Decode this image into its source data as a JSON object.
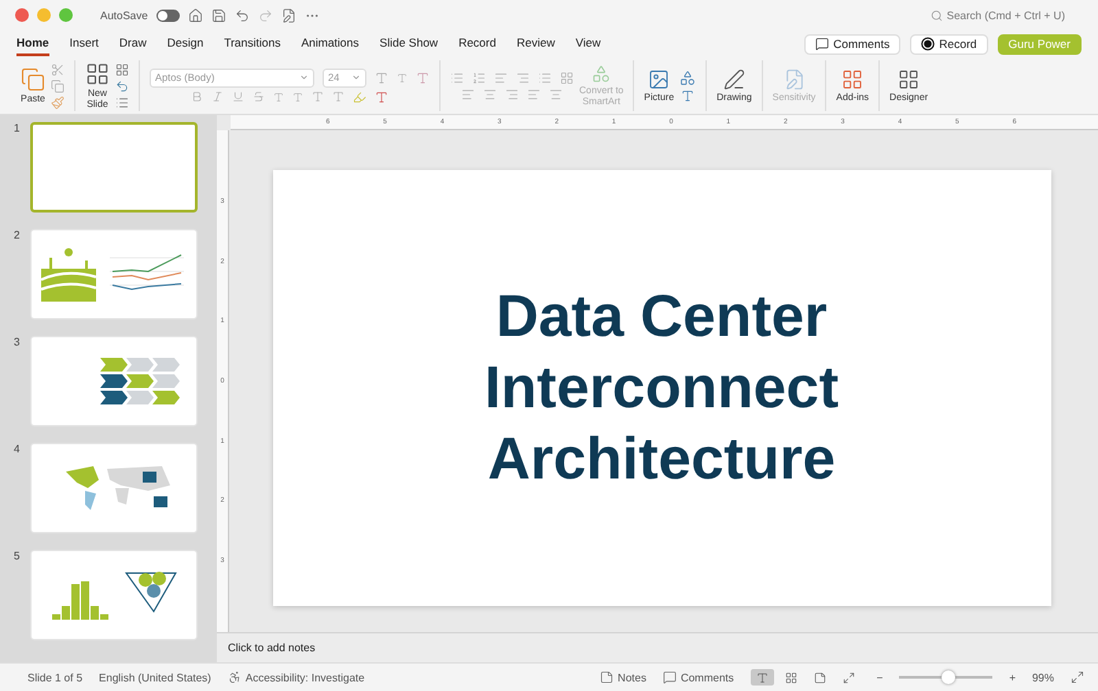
{
  "window": {
    "autosave": {
      "label": "AutoSave",
      "on": false
    },
    "search": {
      "placeholder": "Search (Cmd + Ctrl + U)"
    }
  },
  "tabs": [
    {
      "label": "Home",
      "selected": true
    },
    {
      "label": "Insert",
      "selected": false
    },
    {
      "label": "Draw",
      "selected": false
    },
    {
      "label": "Design",
      "selected": false
    },
    {
      "label": "Transitions",
      "selected": false
    },
    {
      "label": "Animations",
      "selected": false
    },
    {
      "label": "Slide Show",
      "selected": false
    },
    {
      "label": "Record",
      "selected": false
    },
    {
      "label": "Review",
      "selected": false
    },
    {
      "label": "View",
      "selected": false
    }
  ],
  "header_buttons": [
    {
      "kind": "comments",
      "label": "Comments"
    },
    {
      "kind": "record",
      "label": "Record"
    },
    {
      "kind": "guru",
      "label": "Guru Power"
    }
  ],
  "ribbon": {
    "paste": "Paste",
    "new_slide": [
      "New",
      "Slide"
    ],
    "font": "Aptos (Body)",
    "font_size": "24",
    "smartart": [
      "Convert to",
      "SmartArt"
    ],
    "picture": "Picture",
    "drawing": "Drawing",
    "sensitivity": {
      "label": "Sensitivity",
      "disabled": true
    },
    "addins": "Add-ins",
    "designer": "Designer"
  },
  "ruler": {
    "horizontal": [
      "6",
      "5",
      "4",
      "3",
      "2",
      "1",
      "0",
      "1",
      "2",
      "3",
      "4",
      "5",
      "6"
    ],
    "vertical": [
      "3",
      "2",
      "1",
      "0",
      "1",
      "2",
      "3"
    ]
  },
  "slides": [
    {
      "number": "1",
      "kind": "blank",
      "selected": true
    },
    {
      "number": "2",
      "kind": "farm_chart",
      "selected": false
    },
    {
      "number": "3",
      "kind": "arrows",
      "selected": false
    },
    {
      "number": "4",
      "kind": "map",
      "selected": false
    },
    {
      "number": "5",
      "kind": "histogram",
      "selected": false
    }
  ],
  "slide": {
    "title": [
      "Data Center",
      "Interconnect",
      "Architecture"
    ]
  },
  "notes": {
    "placeholder": "Click to add notes"
  },
  "status_bar": {
    "slide": "Slide 1 of 5",
    "language": "English (United States)",
    "accessibility": "Accessibility: Investigate",
    "notes": "Notes",
    "comments": "Comments",
    "views": [
      {
        "kind": "normal",
        "selected": true
      },
      {
        "kind": "sorter",
        "selected": false
      },
      {
        "kind": "reading",
        "selected": false
      },
      {
        "kind": "presenter",
        "selected": false
      }
    ],
    "zoom": {
      "minus": "−",
      "plus": "+",
      "level": 0.52,
      "reading": "99%"
    }
  }
}
